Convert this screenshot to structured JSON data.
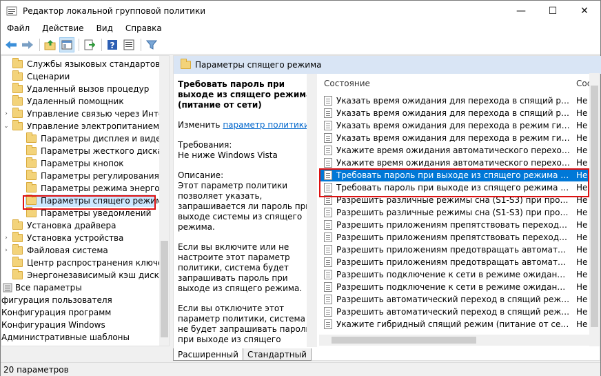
{
  "window": {
    "title": "Редактор локальной групповой политики"
  },
  "controls": {
    "minimize": "—",
    "maximize": "☐",
    "close": "✕"
  },
  "menu": {
    "items": [
      "Файл",
      "Действие",
      "Вид",
      "Справка"
    ]
  },
  "tree": {
    "items": [
      {
        "label": "Службы языковых стандартов",
        "icon": "folder-icon"
      },
      {
        "label": "Сценарии",
        "icon": "folder-icon"
      },
      {
        "label": "Удаленный вызов процедур",
        "icon": "folder-icon"
      },
      {
        "label": "Удаленный помощник",
        "icon": "folder-icon"
      },
      {
        "label": "Управление связью через Интерне",
        "icon": "folder-icon",
        "arrow": ">"
      },
      {
        "label": "Управление электропитанием",
        "icon": "folder-icon",
        "arrow": "v"
      },
      {
        "label": "Параметры дисплея и видео",
        "icon": "folder-icon"
      },
      {
        "label": "Параметры жесткого диска",
        "icon": "folder-icon"
      },
      {
        "label": "Параметры кнопок",
        "icon": "folder-icon"
      },
      {
        "label": "Параметры регулирования мо",
        "icon": "folder-icon"
      },
      {
        "label": "Параметры режима энергосбе",
        "icon": "folder-icon"
      },
      {
        "label": "Параметры спящего режима",
        "icon": "folder-icon"
      },
      {
        "label": "Параметры уведомлений",
        "icon": "folder-icon"
      },
      {
        "label": "Установка драйвера",
        "icon": "folder-icon"
      },
      {
        "label": "Установка устройства",
        "icon": "folder-icon",
        "arrow": ">"
      },
      {
        "label": "Файловая система",
        "icon": "folder-icon",
        "arrow": ">"
      },
      {
        "label": "Центр распространения ключей",
        "icon": "folder-icon"
      },
      {
        "label": "Энергонезависимый кэш диска",
        "icon": "folder-icon"
      },
      {
        "label": "Все параметры",
        "icon": "settings-icon"
      },
      {
        "label": "фигурация пользователя",
        "icon": ""
      },
      {
        "label": "Конфигурация программ",
        "icon": ""
      },
      {
        "label": "Конфигурация Windows",
        "icon": ""
      },
      {
        "label": "Административные шаблоны",
        "icon": ""
      }
    ]
  },
  "right": {
    "header": "Параметры спящего режима",
    "desc": {
      "title": "Требовать пароль при выходе из спящего режима (питание от сети)",
      "edit_prefix": "Изменить",
      "edit_link": "параметр политики",
      "req_label": "Требования:",
      "req_value": "Не ниже Windows Vista",
      "desc_label": "Описание:",
      "desc_text": "Этот параметр политики позволяет указать, запрашивается ли пароль при выходе системы из спящего режима.",
      "desc_text2": "Если вы включите или не настроите этот параметр политики, система будет запрашивать пароль при выходе из спящего режима.",
      "desc_text3": "Если вы отключите этот параметр политики, система не будет запрашивать пароль при выходе из спящего режима."
    },
    "list": {
      "col_state": "Состояние",
      "col_comment": "Сос",
      "rows": [
        {
          "name": "Указать время ожидания для перехода в спящий режим (...",
          "state": "Не"
        },
        {
          "name": "Указать время ожидания для перехода в спящий режим (...",
          "state": "Не"
        },
        {
          "name": "Указать время ожидания для перехода в режим гибернац...",
          "state": "Не"
        },
        {
          "name": "Указать время ожидания для перехода в режим гибернац...",
          "state": "Не"
        },
        {
          "name": "Укажите время ожидания автоматического перехода в сп...",
          "state": "Не"
        },
        {
          "name": "Укажите время ожидания автоматического перехода в сп...",
          "state": "Не"
        },
        {
          "name": "Требовать пароль при выходе из спящего режима (пита...",
          "state": "Не"
        },
        {
          "name": "Требовать пароль при выходе из спящего режима (пита...",
          "state": "Не"
        },
        {
          "name": "Разрешить различные режимы сна (S1-S3) при простое к...",
          "state": "Не"
        },
        {
          "name": "Разрешить различные режимы сна (S1-S3) при простое к...",
          "state": "Не"
        },
        {
          "name": "Разрешить приложениям препятствовать переходу систе...",
          "state": "Не"
        },
        {
          "name": "Разрешить приложениям препятствовать переходу систе...",
          "state": "Не"
        },
        {
          "name": "Разрешить приложениям предотвращать автоматически...",
          "state": "Не"
        },
        {
          "name": "Разрешить приложениям предотвращать автоматически...",
          "state": "Не"
        },
        {
          "name": "Разрешить подключение к сети в режиме ожидания с по...",
          "state": "Не"
        },
        {
          "name": "Разрешить подключение к сети в режиме ожидания с по...",
          "state": "Не"
        },
        {
          "name": "Разрешить автоматический переход в спящий режим с о...",
          "state": "Не"
        },
        {
          "name": "Разрешить автоматический переход в спящий режим с о...",
          "state": "Не"
        },
        {
          "name": "Укажите гибридный спящий режим (питание от сети)",
          "state": "Не"
        }
      ]
    }
  },
  "tabs": {
    "extended": "Расширенный",
    "standard": "Стандартный"
  },
  "status": {
    "text": "20 параметров"
  },
  "colors": {
    "selection": "#0078d7",
    "highlight": "#d11111",
    "header_bg": "#d9e5f5"
  }
}
